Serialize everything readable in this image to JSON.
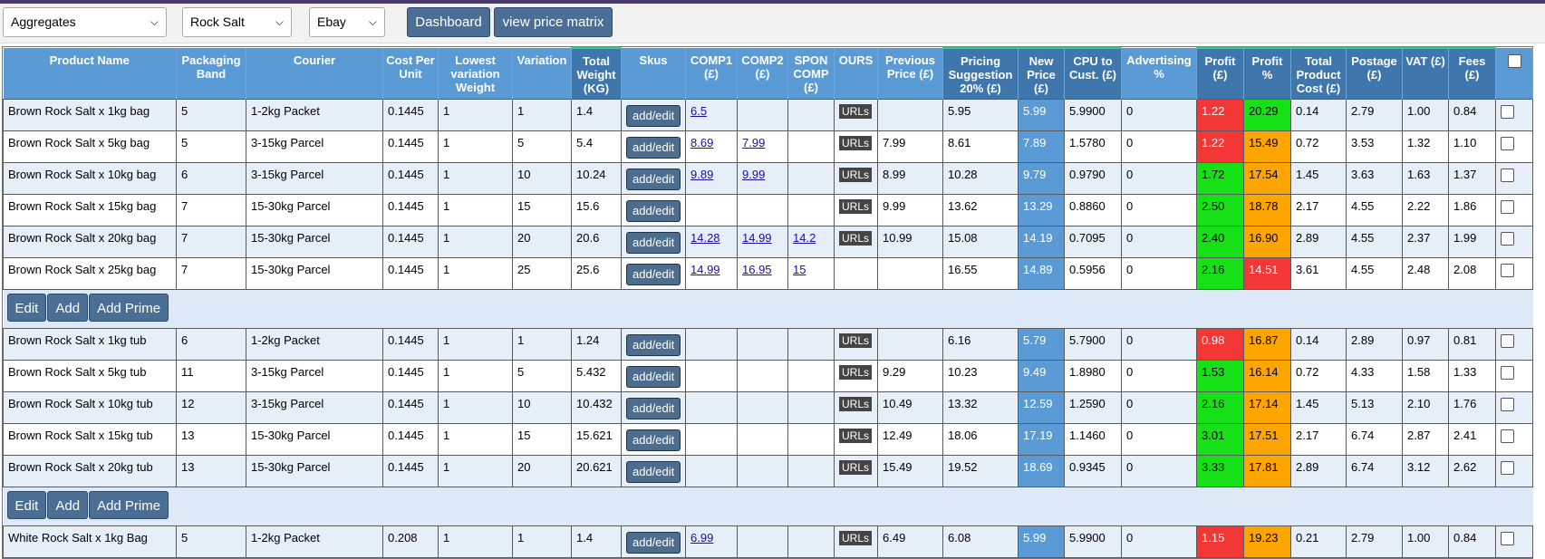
{
  "toolbar": {
    "filters": [
      "Aggregates",
      "Rock Salt",
      "Ebay"
    ],
    "buttons": [
      "Dashboard",
      "view price matrix"
    ]
  },
  "columns": [
    "Product Name",
    "Packaging Band",
    "Courier",
    "Cost Per Unit",
    "Lowest variation Weight",
    "Variation",
    "Total Weight (KG)",
    "Skus",
    "COMP1 (£)",
    "COMP2 (£)",
    "SPON COMP (£)",
    "OURS",
    "Previous Price (£)",
    "Pricing Suggestion 20% (£)",
    "New Price (£)",
    "CPU to Cust. (£)",
    "Advertising %",
    "Profit (£)",
    "Profit %",
    "Total Product Cost (£)",
    "Postage (£)",
    "VAT (£)",
    "Fees (£)",
    ""
  ],
  "labels": {
    "skus_button": "add/edit",
    "ours_badge": "URLs"
  },
  "actions": [
    "Edit",
    "Add",
    "Add Prime"
  ],
  "groups": [
    {
      "rows": [
        {
          "name": "Brown Rock Salt x 1kg bag",
          "band": "5",
          "courier": "1-2kg Packet",
          "cpu": "0.1445",
          "lvw": "1",
          "variation": "1",
          "weight": "1.4",
          "comp1": "6.5",
          "comp2": "",
          "spon": "",
          "ours": true,
          "prev": "",
          "suggest": "5.95",
          "newp": "5.99",
          "cpuc": "5.9900",
          "adv": "0",
          "profit": "1.22",
          "profit_c": "rd",
          "pct": "20.29",
          "pct_c": "g",
          "tpc": "0.14",
          "post": "2.79",
          "vat": "1.00",
          "fees": "0.84"
        },
        {
          "name": "Brown Rock Salt x 5kg bag",
          "band": "5",
          "courier": "3-15kg Parcel",
          "cpu": "0.1445",
          "lvw": "1",
          "variation": "5",
          "weight": "5.4",
          "comp1": "8.69",
          "comp2": "7.99",
          "spon": "",
          "ours": true,
          "prev": "7.99",
          "suggest": "8.61",
          "newp": "7.89",
          "cpuc": "1.5780",
          "adv": "0",
          "profit": "1.22",
          "profit_c": "rd",
          "pct": "15.49",
          "pct_c": "o",
          "tpc": "0.72",
          "post": "3.53",
          "vat": "1.32",
          "fees": "1.10"
        },
        {
          "name": "Brown Rock Salt x 10kg bag",
          "band": "6",
          "courier": "3-15kg Parcel",
          "cpu": "0.1445",
          "lvw": "1",
          "variation": "10",
          "weight": "10.24",
          "comp1": "9.89",
          "comp2": "9.99",
          "spon": "",
          "ours": true,
          "prev": "8.99",
          "suggest": "10.28",
          "newp": "9.79",
          "cpuc": "0.9790",
          "adv": "0",
          "profit": "1.72",
          "profit_c": "g",
          "pct": "17.54",
          "pct_c": "o",
          "tpc": "1.45",
          "post": "3.63",
          "vat": "1.63",
          "fees": "1.37"
        },
        {
          "name": "Brown Rock Salt x 15kg bag",
          "band": "7",
          "courier": "15-30kg Parcel",
          "cpu": "0.1445",
          "lvw": "1",
          "variation": "15",
          "weight": "15.6",
          "comp1": "",
          "comp2": "",
          "spon": "",
          "ours": true,
          "prev": "9.99",
          "suggest": "13.62",
          "newp": "13.29",
          "cpuc": "0.8860",
          "adv": "0",
          "profit": "2.50",
          "profit_c": "g",
          "pct": "18.78",
          "pct_c": "o",
          "tpc": "2.17",
          "post": "4.55",
          "vat": "2.22",
          "fees": "1.86"
        },
        {
          "name": "Brown Rock Salt x 20kg bag",
          "band": "7",
          "courier": "15-30kg Parcel",
          "cpu": "0.1445",
          "lvw": "1",
          "variation": "20",
          "weight": "20.6",
          "comp1": "14.28",
          "comp2": "14.99",
          "spon": "14.2",
          "ours": true,
          "prev": "10.99",
          "suggest": "15.08",
          "newp": "14.19",
          "cpuc": "0.7095",
          "adv": "0",
          "profit": "2.40",
          "profit_c": "g",
          "pct": "16.90",
          "pct_c": "o",
          "tpc": "2.89",
          "post": "4.55",
          "vat": "2.37",
          "fees": "1.99"
        },
        {
          "name": "Brown Rock Salt x 25kg bag",
          "band": "7",
          "courier": "15-30kg Parcel",
          "cpu": "0.1445",
          "lvw": "1",
          "variation": "25",
          "weight": "25.6",
          "comp1": "14.99",
          "comp2": "16.95",
          "spon": "15",
          "ours": false,
          "prev": "",
          "suggest": "16.55",
          "newp": "14.89",
          "cpuc": "0.5956",
          "adv": "0",
          "profit": "2.16",
          "profit_c": "g",
          "pct": "14.51",
          "pct_c": "rd",
          "tpc": "3.61",
          "post": "4.55",
          "vat": "2.48",
          "fees": "2.08"
        }
      ]
    },
    {
      "rows": [
        {
          "name": "Brown Rock Salt x 1kg tub",
          "band": "6",
          "courier": "1-2kg Packet",
          "cpu": "0.1445",
          "lvw": "1",
          "variation": "1",
          "weight": "1.24",
          "comp1": "",
          "comp2": "",
          "spon": "",
          "ours": true,
          "prev": "",
          "suggest": "6.16",
          "newp": "5.79",
          "cpuc": "5.7900",
          "adv": "0",
          "profit": "0.98",
          "profit_c": "rd",
          "pct": "16.87",
          "pct_c": "o",
          "tpc": "0.14",
          "post": "2.89",
          "vat": "0.97",
          "fees": "0.81"
        },
        {
          "name": "Brown Rock Salt x 5kg tub",
          "band": "11",
          "courier": "3-15kg Parcel",
          "cpu": "0.1445",
          "lvw": "1",
          "variation": "5",
          "weight": "5.432",
          "comp1": "",
          "comp2": "",
          "spon": "",
          "ours": true,
          "prev": "9.29",
          "suggest": "10.23",
          "newp": "9.49",
          "cpuc": "1.8980",
          "adv": "0",
          "profit": "1.53",
          "profit_c": "g",
          "pct": "16.14",
          "pct_c": "o",
          "tpc": "0.72",
          "post": "4.33",
          "vat": "1.58",
          "fees": "1.33"
        },
        {
          "name": "Brown Rock Salt x 10kg tub",
          "band": "12",
          "courier": "3-15kg Parcel",
          "cpu": "0.1445",
          "lvw": "1",
          "variation": "10",
          "weight": "10.432",
          "comp1": "",
          "comp2": "",
          "spon": "",
          "ours": true,
          "prev": "10.49",
          "suggest": "13.32",
          "newp": "12.59",
          "cpuc": "1.2590",
          "adv": "0",
          "profit": "2.16",
          "profit_c": "g",
          "pct": "17.14",
          "pct_c": "o",
          "tpc": "1.45",
          "post": "5.13",
          "vat": "2.10",
          "fees": "1.76"
        },
        {
          "name": "Brown Rock Salt x 15kg tub",
          "band": "13",
          "courier": "15-30kg Parcel",
          "cpu": "0.1445",
          "lvw": "1",
          "variation": "15",
          "weight": "15.621",
          "comp1": "",
          "comp2": "",
          "spon": "",
          "ours": true,
          "prev": "12.49",
          "suggest": "18.06",
          "newp": "17.19",
          "cpuc": "1.1460",
          "adv": "0",
          "profit": "3.01",
          "profit_c": "g",
          "pct": "17.51",
          "pct_c": "o",
          "tpc": "2.17",
          "post": "6.74",
          "vat": "2.87",
          "fees": "2.41"
        },
        {
          "name": "Brown Rock Salt x 20kg tub",
          "band": "13",
          "courier": "15-30kg Parcel",
          "cpu": "0.1445",
          "lvw": "1",
          "variation": "20",
          "weight": "20.621",
          "comp1": "",
          "comp2": "",
          "spon": "",
          "ours": true,
          "prev": "15.49",
          "suggest": "19.52",
          "newp": "18.69",
          "cpuc": "0.9345",
          "adv": "0",
          "profit": "3.33",
          "profit_c": "g",
          "pct": "17.81",
          "pct_c": "o",
          "tpc": "2.89",
          "post": "6.74",
          "vat": "3.12",
          "fees": "2.62"
        }
      ]
    },
    {
      "rows": [
        {
          "name": "White Rock Salt x 1kg Bag",
          "band": "5",
          "courier": "1-2kg Packet",
          "cpu": "0.208",
          "lvw": "1",
          "variation": "1",
          "weight": "1.4",
          "comp1": "6.99",
          "comp2": "",
          "spon": "",
          "ours": true,
          "prev": "6.49",
          "suggest": "6.08",
          "newp": "5.99",
          "cpuc": "5.9900",
          "adv": "0",
          "profit": "1.15",
          "profit_c": "rd",
          "pct": "19.23",
          "pct_c": "o",
          "tpc": "0.21",
          "post": "2.79",
          "vat": "1.00",
          "fees": "0.84"
        }
      ]
    }
  ],
  "colors": {
    "header": "#5b9bd5",
    "header_dark": "#3f77ad",
    "green": "#16e016",
    "red": "#f33636",
    "orange": "#ffa500"
  }
}
